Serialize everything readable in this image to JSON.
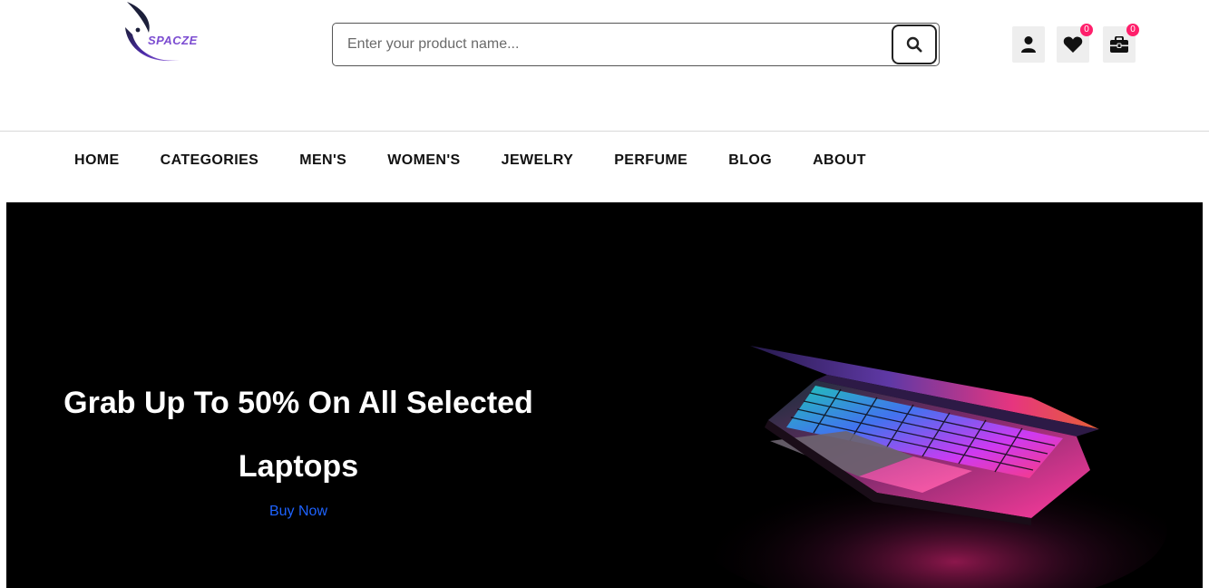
{
  "brand": {
    "name": "SPACZE",
    "accent": "#7c4dd1"
  },
  "search": {
    "placeholder": "Enter your product name...",
    "value": "",
    "button_icon": "search-icon"
  },
  "header_actions": [
    {
      "name": "account",
      "icon": "user-icon"
    },
    {
      "name": "wishlist",
      "icon": "heart-icon",
      "count": "0"
    },
    {
      "name": "cart",
      "icon": "briefcase-icon",
      "count": "0"
    }
  ],
  "nav": {
    "items": [
      {
        "label": "HOME"
      },
      {
        "label": "CATEGORIES"
      },
      {
        "label": "MEN'S"
      },
      {
        "label": "WOMEN'S"
      },
      {
        "label": "JEWELRY"
      },
      {
        "label": "PERFUME"
      },
      {
        "label": "BLOG"
      },
      {
        "label": "ABOUT"
      }
    ]
  },
  "hero": {
    "title": "Grab Up To 50% On All Selected Laptops",
    "cta": "Buy Now",
    "background": "#000000",
    "cta_color": "#1e63ff"
  },
  "colors": {
    "badge": "#ff1f6b",
    "icon_bg": "#eeeeee"
  }
}
